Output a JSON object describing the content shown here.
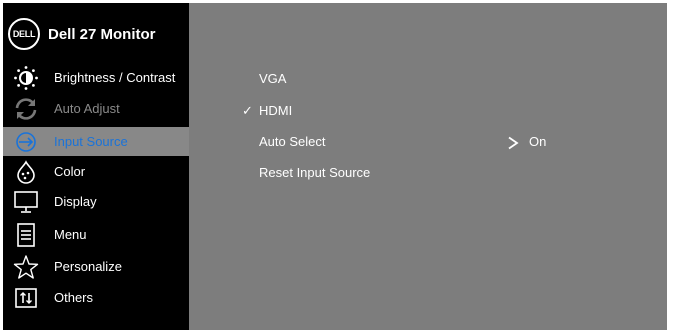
{
  "header": {
    "logo_text": "DELL",
    "title": "Dell 27 Monitor"
  },
  "menu": {
    "items": [
      {
        "label": "Brightness / Contrast",
        "icon": "brightness-icon",
        "state": "normal"
      },
      {
        "label": "Auto Adjust",
        "icon": "auto-adjust-icon",
        "state": "disabled"
      },
      {
        "label": "Input Source",
        "icon": "input-source-icon",
        "state": "selected"
      },
      {
        "label": "Color",
        "icon": "color-icon",
        "state": "normal"
      },
      {
        "label": "Display",
        "icon": "display-icon",
        "state": "normal"
      },
      {
        "label": "Menu",
        "icon": "menu-icon",
        "state": "normal"
      },
      {
        "label": "Personalize",
        "icon": "star-icon",
        "state": "normal"
      },
      {
        "label": "Others",
        "icon": "others-icon",
        "state": "normal"
      }
    ]
  },
  "submenu": {
    "options": [
      {
        "label": "VGA",
        "checked": false
      },
      {
        "label": "HDMI",
        "checked": true
      },
      {
        "label": "Auto Select",
        "checked": false
      },
      {
        "label": "Reset Input Source",
        "checked": false
      }
    ],
    "auto_select_value": "On",
    "check_mark": "✓"
  },
  "colors": {
    "sidebar_bg": "#000000",
    "content_bg": "#7d7d7d",
    "selected_bg": "#888888",
    "selected_text": "#1a73d9",
    "disabled_text": "#8a8a8a"
  }
}
